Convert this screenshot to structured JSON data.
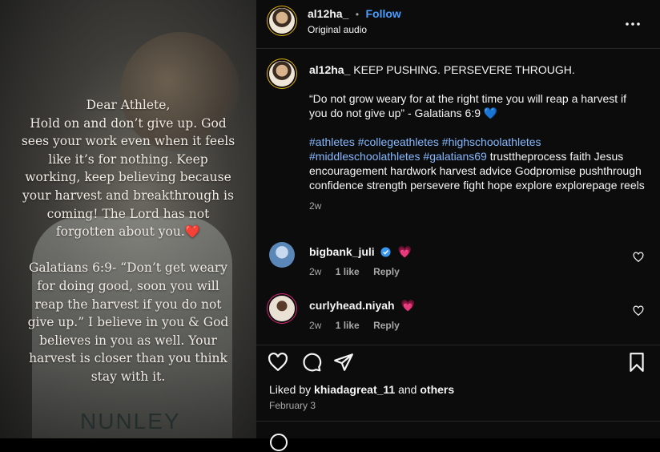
{
  "media": {
    "overlay_text": "Dear Athlete,\nHold on and don’t give up. God\nsees your work even when it feels\nlike it’s for nothing. Keep\nworking, keep believing because\nyour harvest and breakthrough is\ncoming! The Lord has not\nforgotten about you.❤️\n\nGalatians 6:9- “Don’t get weary\nfor doing good, soon you will\nreap the harvest if you do not\ngive up.” I believe in you & God\nbelieves in you as well. Your\nharvest is closer than you think\nstay with it.",
    "jersey_text": "NUNLEY"
  },
  "header": {
    "username": "al12ha_",
    "separator": "•",
    "follow_label": "Follow",
    "audio_label": "Original audio"
  },
  "caption": {
    "username": "al12ha_",
    "line1": "KEEP PUSHING. PERSEVERE THROUGH.",
    "quote": "“Do not grow weary for at the right time you will reap a harvest if you do not give up” - Galatians 6:9 💙",
    "hashtags": "#athletes #collegeathletes #highschoolathletes #middleschoolathletes #galatians69",
    "tags_plain": "trusttheprocess faith Jesus encouragement hardwork harvest advice Godpromise pushthrough confidence strength persevere fight hope explore explorepage reels",
    "time": "2w"
  },
  "comments": [
    {
      "username": "bigbank_juli",
      "text": "💗",
      "time": "2w",
      "likes": "1 like",
      "reply": "Reply",
      "verified": true
    },
    {
      "username": "curlyhead.niyah",
      "text": "💗",
      "time": "2w",
      "likes": "1 like",
      "reply": "Reply",
      "verified": false
    }
  ],
  "likes": {
    "prefix": "Liked by ",
    "user": "khiadagreat_11",
    "and": " and ",
    "others": "others"
  },
  "date": "February 3",
  "colors": {
    "accent": "#4a9eff",
    "hashtag": "#85b8ff",
    "verified": "#3897f0",
    "heart": "#e1306c"
  }
}
